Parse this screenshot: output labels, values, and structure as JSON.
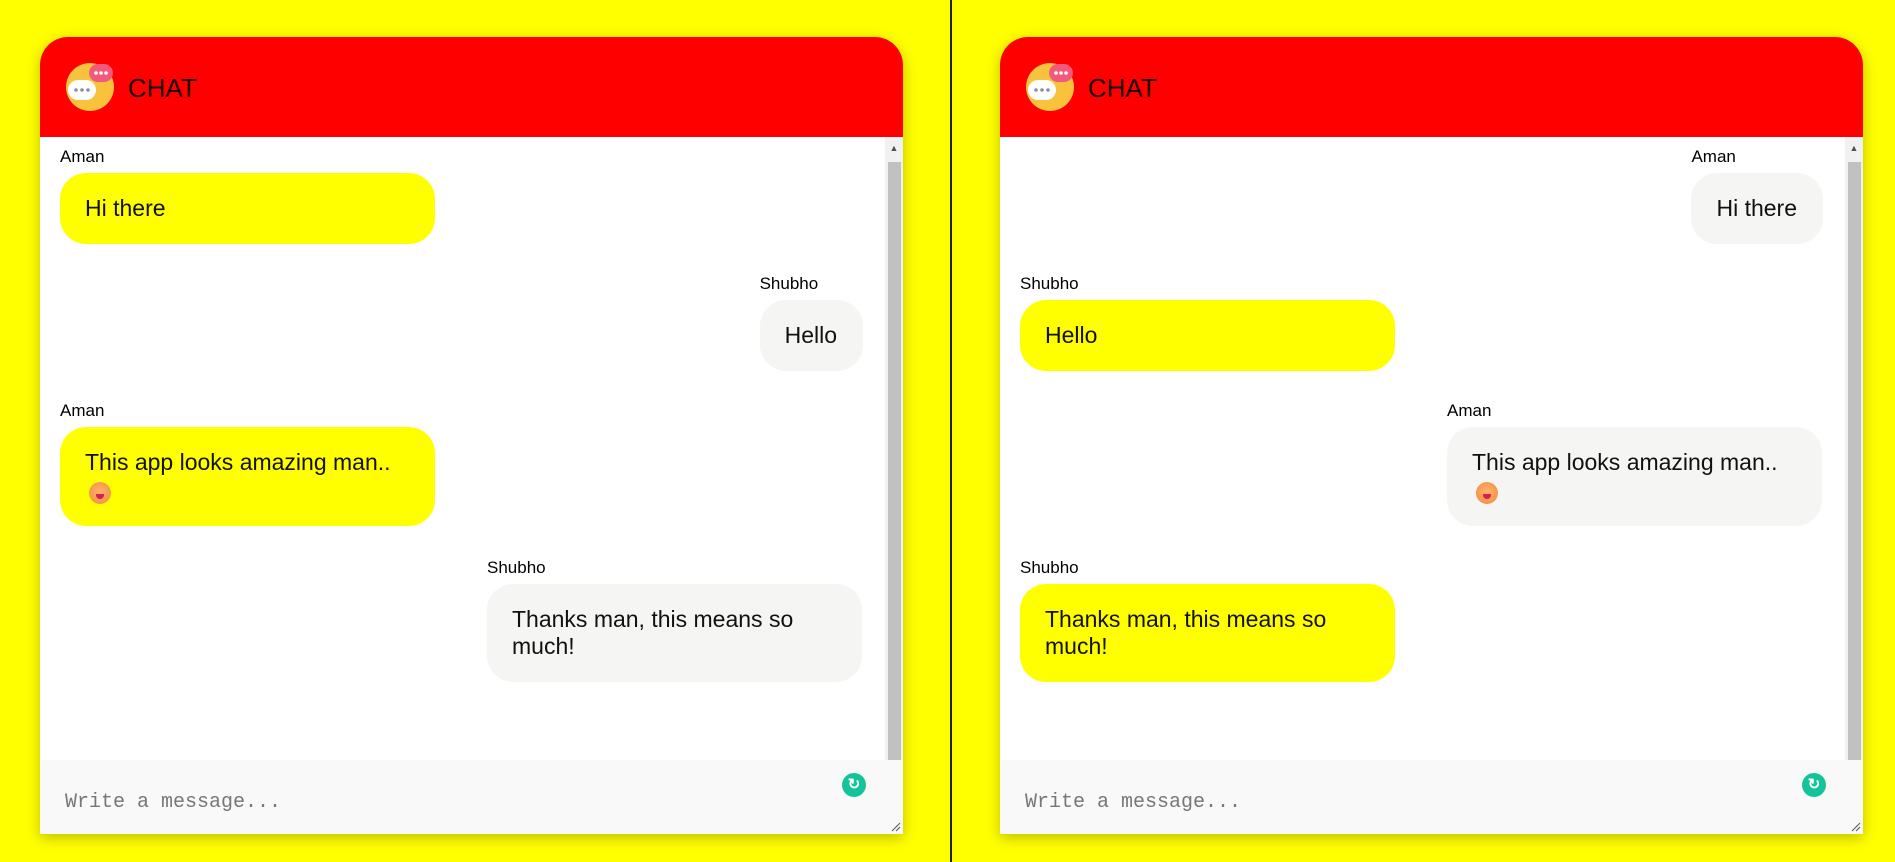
{
  "app": {
    "title": "CHAT"
  },
  "composer": {
    "placeholder": "Write a message..."
  },
  "panes": [
    {
      "messages": [
        {
          "sender": "Aman",
          "text": "Hi there",
          "side": "left",
          "color": "yellow"
        },
        {
          "sender": "Shubho",
          "text": "Hello",
          "side": "right",
          "color": "grey"
        },
        {
          "sender": "Aman",
          "text": "This app looks amazing man..",
          "emoji": "face-emoji",
          "side": "left",
          "color": "yellow"
        },
        {
          "sender": "Shubho",
          "text": "Thanks man, this means so much!",
          "side": "right",
          "color": "grey"
        }
      ]
    },
    {
      "messages": [
        {
          "sender": "Aman",
          "text": "Hi there",
          "side": "right",
          "color": "grey"
        },
        {
          "sender": "Shubho",
          "text": "Hello",
          "side": "left",
          "color": "yellow"
        },
        {
          "sender": "Aman",
          "text": "This app looks amazing man..",
          "emoji": "face-emoji",
          "side": "right",
          "color": "grey"
        },
        {
          "sender": "Shubho",
          "text": "Thanks man, this means so much!",
          "side": "left",
          "color": "yellow"
        }
      ]
    }
  ],
  "colors": {
    "background": "#ffff00",
    "header": "#ff0000",
    "own_bubble": "#ffff00",
    "other_bubble": "#f5f5f3",
    "grammarly": "#15c39a"
  },
  "icons": {
    "logo": "chat-bubbles-logo-icon",
    "grammarly": "grammarly-icon"
  }
}
